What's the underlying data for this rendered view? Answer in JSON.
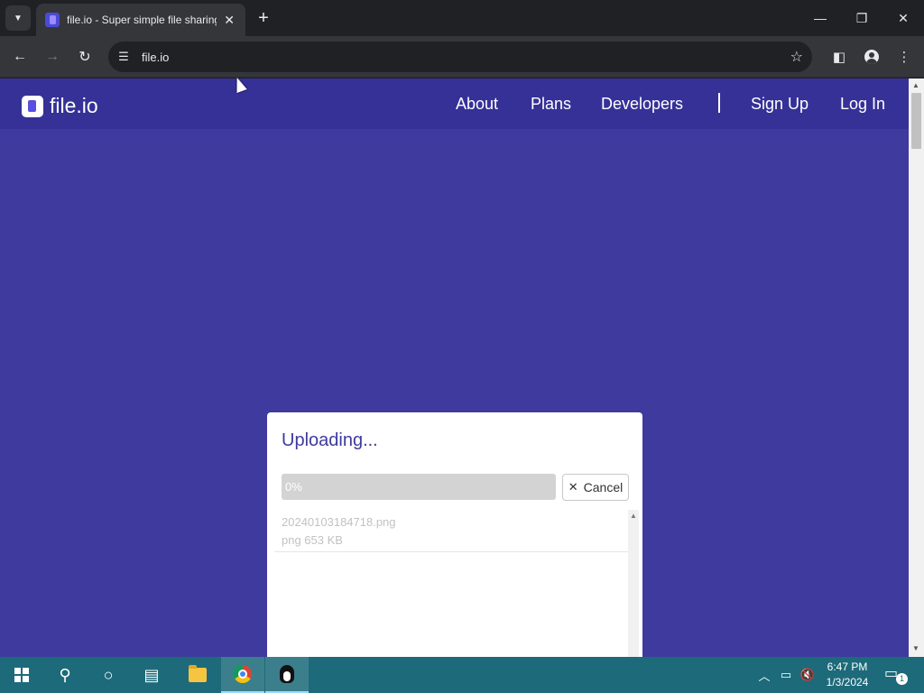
{
  "browser": {
    "tab_title": "file.io - Super simple file sharing",
    "url": "file.io"
  },
  "site": {
    "logo_text": "file.io",
    "nav": [
      "About",
      "Plans",
      "Developers",
      "Sign Up",
      "Log In"
    ]
  },
  "upload": {
    "heading": "Uploading...",
    "progress_text": "0%",
    "progress_fraction": 0,
    "cancel_label": "Cancel",
    "file_name": "20240103184718.png",
    "file_meta": "png 653 KB"
  },
  "taskbar": {
    "time": "6:47 PM",
    "date": "1/3/2024",
    "notification_count": "1"
  }
}
